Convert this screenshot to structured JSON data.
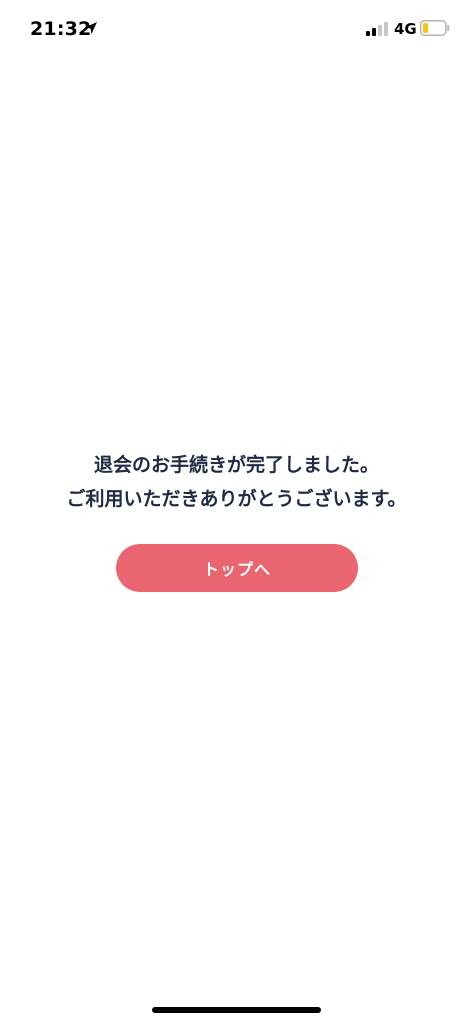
{
  "status_bar": {
    "time": "21:32",
    "network": "4G",
    "icons": [
      "location-arrow-icon",
      "signal-bars-icon",
      "battery-icon"
    ],
    "battery_color": "#f5c518"
  },
  "main": {
    "message_lines": [
      "退会のお手続きが完了しました。",
      "ご利用いただきありがとうございます。"
    ],
    "top_button_label": "トップへ",
    "accent_color": "#e9656f",
    "text_color": "#1f2a44"
  }
}
